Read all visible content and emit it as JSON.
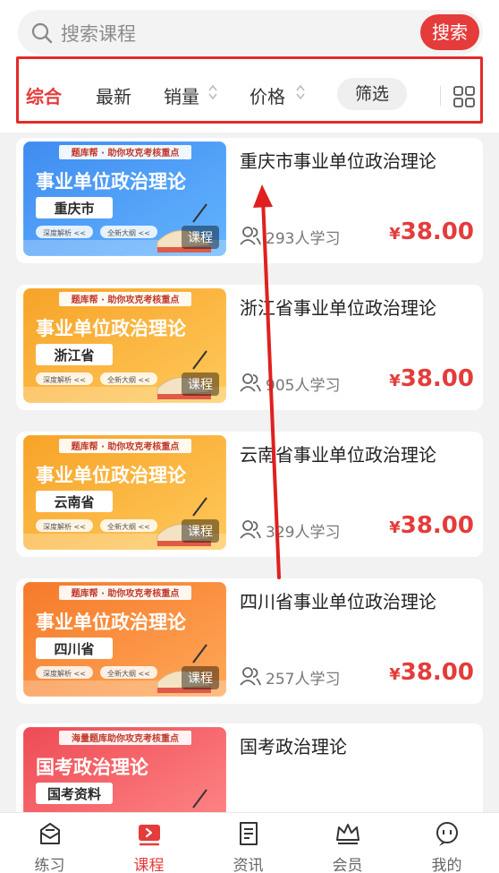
{
  "search": {
    "placeholder": "搜索课程",
    "button": "搜索"
  },
  "sort": {
    "items": [
      "综合",
      "最新",
      "销量",
      "价格"
    ],
    "filter": "筛选"
  },
  "courses": [
    {
      "title": "重庆市事业单位政治理论",
      "students": "293人学习",
      "price": "38.00",
      "currency": "¥",
      "tag": "课程",
      "thumb": {
        "top": "题库帮 · 助你攻克考核重点",
        "main": "事业单位政治理论",
        "region": "重庆市",
        "left_label": "深度解析 <<",
        "right_label": "全新大纲 <<",
        "colors": [
          "#3f8cf0",
          "#63b4ff"
        ]
      }
    },
    {
      "title": "浙江省事业单位政治理论",
      "students": "905人学习",
      "price": "38.00",
      "currency": "¥",
      "tag": "课程",
      "thumb": {
        "top": "题库帮 · 助你攻克考核重点",
        "main": "事业单位政治理论",
        "region": "浙江省",
        "left_label": "深度解析 <<",
        "right_label": "全新大纲 <<",
        "colors": [
          "#f7a328",
          "#ffc95a"
        ]
      }
    },
    {
      "title": "云南省事业单位政治理论",
      "students": "329人学习",
      "price": "38.00",
      "currency": "¥",
      "tag": "课程",
      "thumb": {
        "top": "题库帮 · 助你攻克考核重点",
        "main": "事业单位政治理论",
        "region": "云南省",
        "left_label": "深度解析 <<",
        "right_label": "全新大纲 <<",
        "colors": [
          "#f7a328",
          "#ffc95a"
        ]
      }
    },
    {
      "title": "四川省事业单位政治理论",
      "students": "257人学习",
      "price": "38.00",
      "currency": "¥",
      "tag": "课程",
      "thumb": {
        "top": "题库帮 · 助你攻克考核重点",
        "main": "事业单位政治理论",
        "region": "四川省",
        "left_label": "深度解析 <<",
        "right_label": "全新大纲 <<",
        "colors": [
          "#f57a2a",
          "#ffa858"
        ]
      }
    },
    {
      "title": "国考政治理论",
      "students": "",
      "price": "",
      "currency": "",
      "tag": "",
      "thumb": {
        "top": "海量题库助你攻克考核重点",
        "main": "国考政治理论",
        "region": "国考资料",
        "left_label": "",
        "right_label": "",
        "colors": [
          "#ee4b55",
          "#ff8a8a"
        ]
      }
    }
  ],
  "tabbar": [
    {
      "label": "练习",
      "icon": "practice-icon",
      "active": false
    },
    {
      "label": "课程",
      "icon": "course-icon",
      "active": true
    },
    {
      "label": "资讯",
      "icon": "news-icon",
      "active": false
    },
    {
      "label": "会员",
      "icon": "vip-crown-icon",
      "active": false
    },
    {
      "label": "我的",
      "icon": "profile-chat-icon",
      "active": false
    }
  ],
  "colors": {
    "accent": "#e53b3b",
    "highlight_border": "#e52a2a"
  }
}
